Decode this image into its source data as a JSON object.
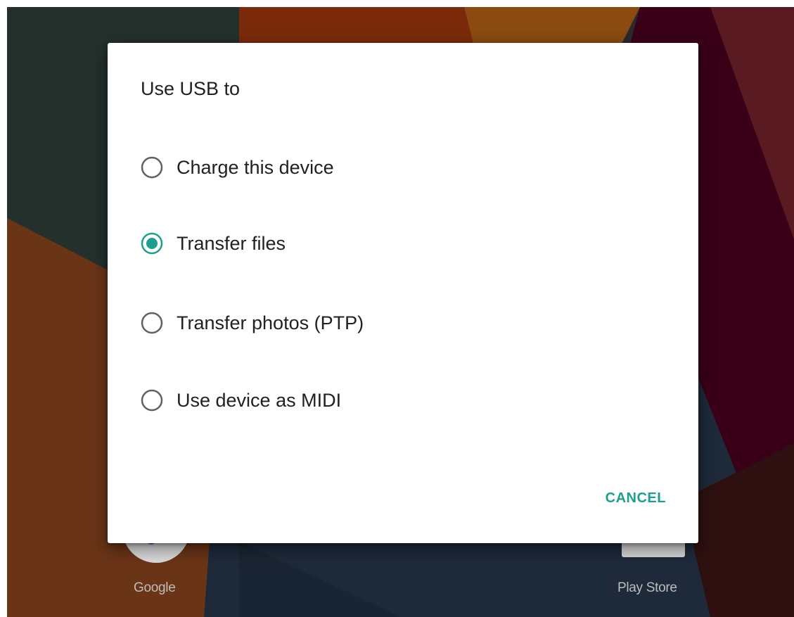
{
  "colors": {
    "accent": "#1f9e8e",
    "dialog_bg": "#ffffff",
    "text_primary": "#212121",
    "radio_unchecked": "#616161"
  },
  "home": {
    "apps": [
      {
        "label": "Google",
        "icon": "google-icon"
      },
      {
        "label": "Play Store",
        "icon": "play-store-icon"
      }
    ]
  },
  "dialog": {
    "title": "Use USB to",
    "options": [
      {
        "label": "Charge this device",
        "selected": false
      },
      {
        "label": "Transfer files",
        "selected": true
      },
      {
        "label": "Transfer photos (PTP)",
        "selected": false
      },
      {
        "label": "Use device as MIDI",
        "selected": false
      }
    ],
    "cancel_label": "CANCEL"
  }
}
